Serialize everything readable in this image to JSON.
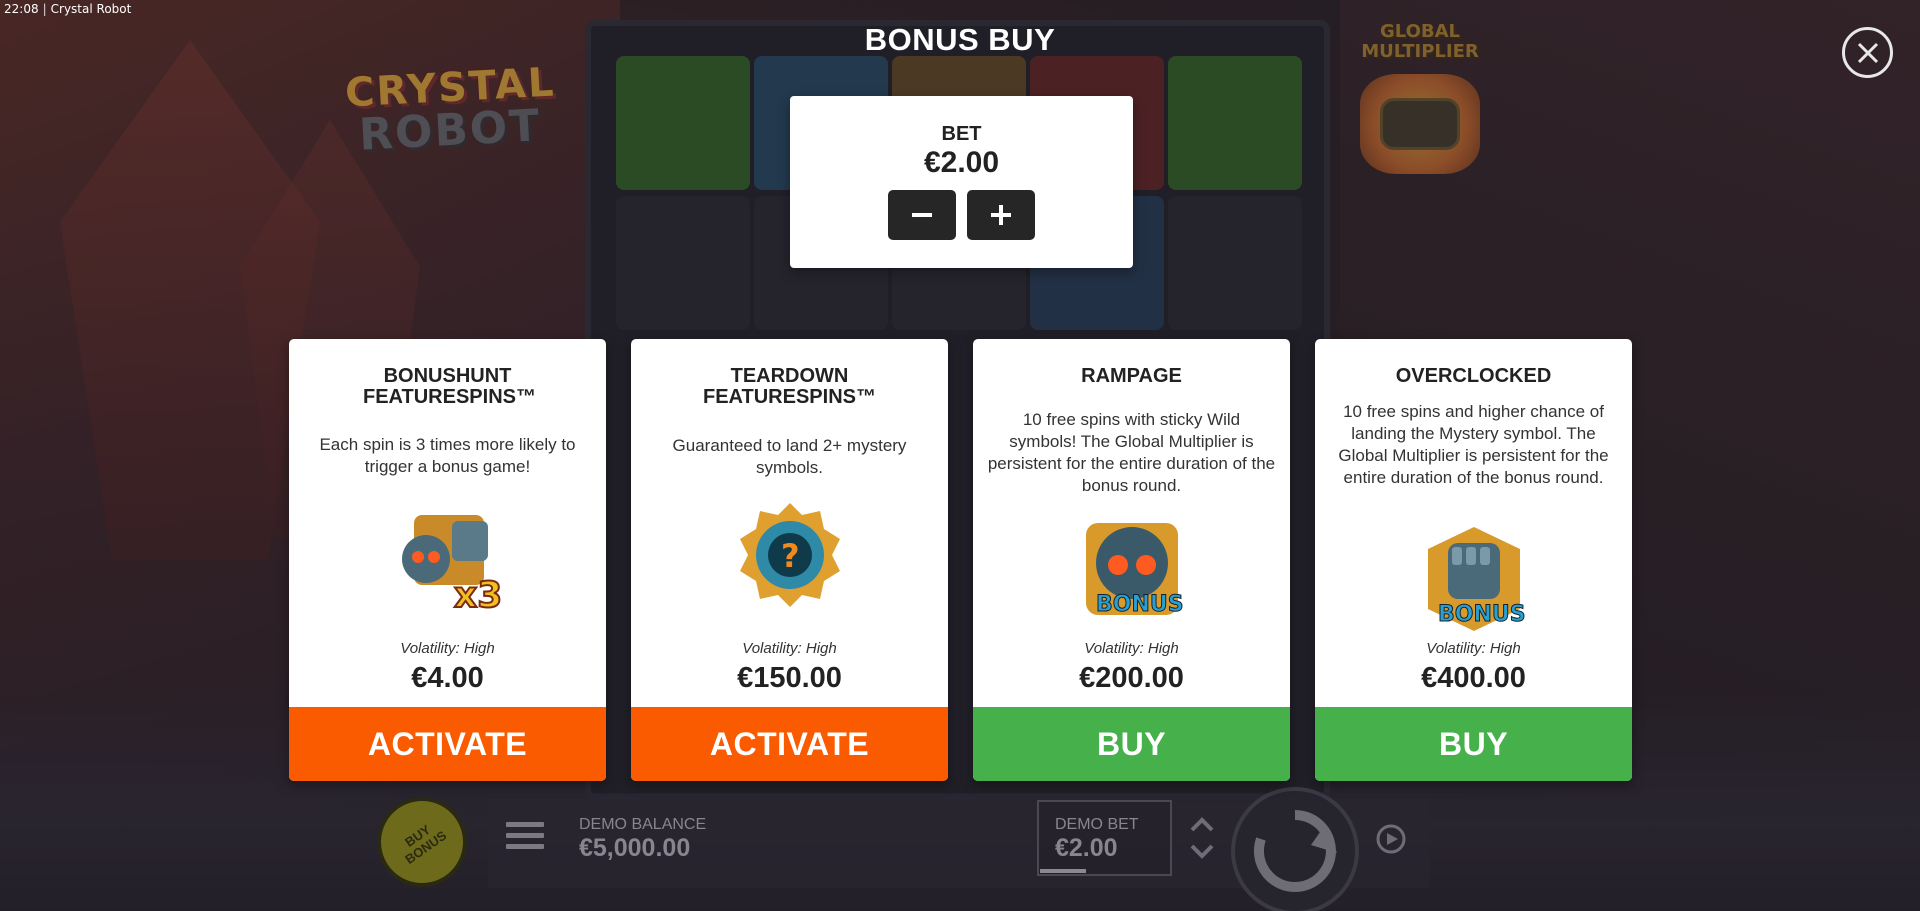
{
  "status_bar": {
    "time": "22:08",
    "separator": "|",
    "app_title": "Crystal Robot"
  },
  "logo": {
    "line1": "CRYSTAL",
    "line2": "ROBOT"
  },
  "global_multiplier": {
    "title_line1": "GLOBAL",
    "title_line2": "MULTIPLIER"
  },
  "dialog": {
    "title": "BONUS BUY"
  },
  "bet": {
    "label": "BET",
    "value": "€2.00",
    "decrease_icon": "minus-icon",
    "increase_icon": "plus-icon"
  },
  "cards": [
    {
      "title": "BONUSHUNT FEATURESPINS™",
      "description": "Each spin is 3 times more likely to trigger a bonus game!",
      "icon": "bonushunt-x3-icon",
      "volatility": "Volatility: High",
      "price": "€4.00",
      "action": "ACTIVATE",
      "action_color": "#fa5a00"
    },
    {
      "title": "TEARDOWN FEATURESPINS™",
      "description": "Guaranteed to land 2+ mystery symbols.",
      "icon": "mystery-gear-icon",
      "volatility": "Volatility: High",
      "price": "€150.00",
      "action": "ACTIVATE",
      "action_color": "#fa5a00"
    },
    {
      "title": "RAMPAGE",
      "description": "10 free spins with sticky Wild symbols! The Global Multiplier is persistent for the entire duration of the bonus round.",
      "icon": "robot-head-bonus-icon",
      "volatility": "Volatility: High",
      "price": "€200.00",
      "action": "BUY",
      "action_color": "#46b04a"
    },
    {
      "title": "OVERCLOCKED",
      "description": "10 free spins and higher chance of landing the Mystery symbol. The Global Multiplier is persistent for the entire duration of the bonus round.",
      "icon": "robot-fist-bonus-icon",
      "volatility": "Volatility: High",
      "price": "€400.00",
      "action": "BUY",
      "action_color": "#46b04a"
    }
  ],
  "bottom_bar": {
    "buy_bonus_line1": "BUY",
    "buy_bonus_line2": "BONUS",
    "balance_label": "DEMO BALANCE",
    "balance_value": "€5,000.00",
    "bet_label": "DEMO BET",
    "bet_value": "€2.00"
  }
}
